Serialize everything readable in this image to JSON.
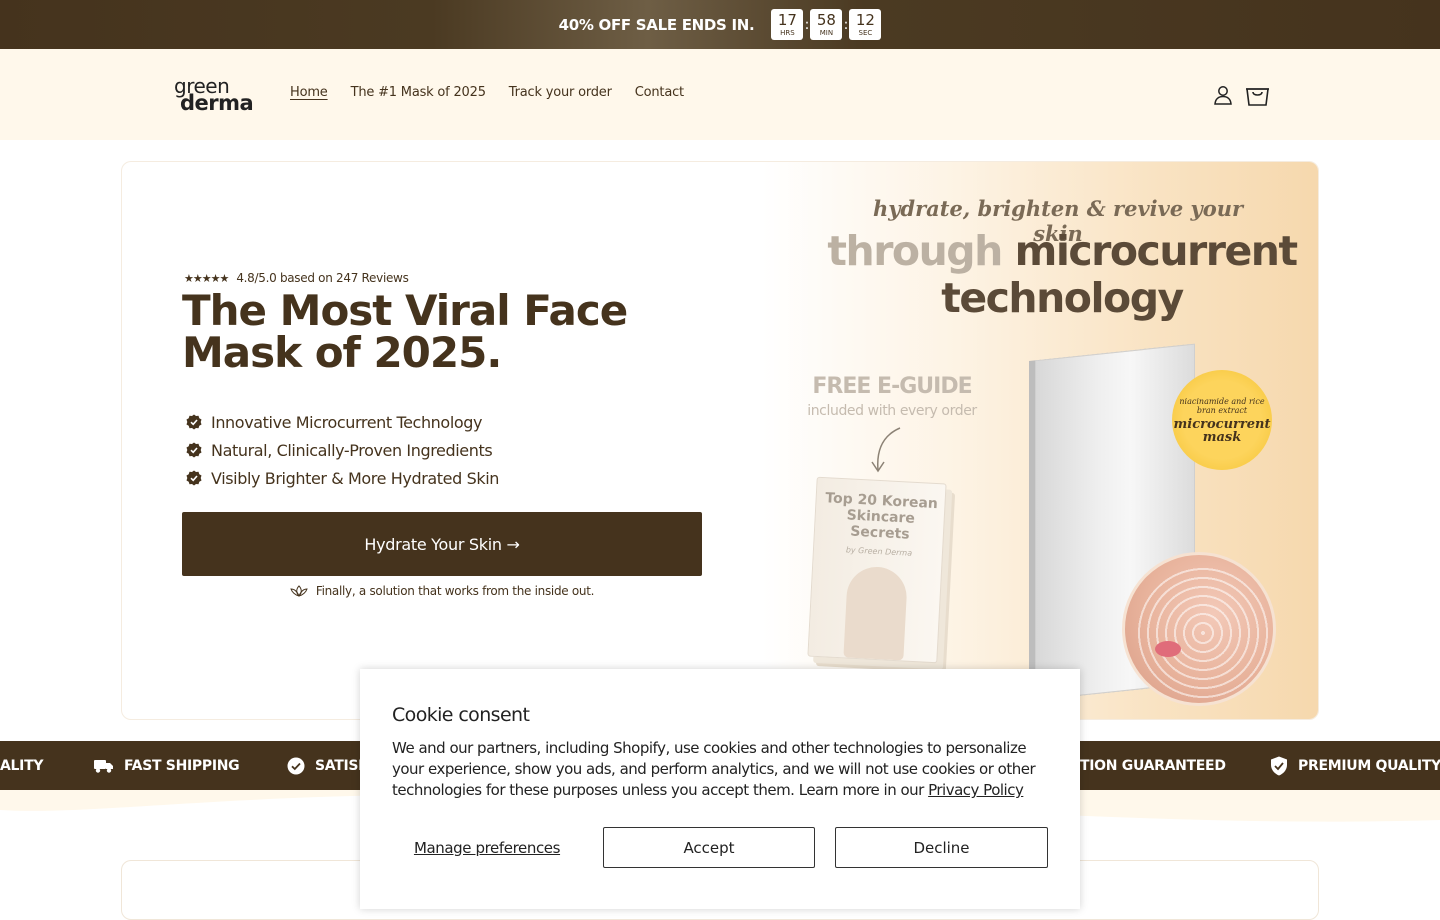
{
  "announcement": {
    "text": "40% OFF SALE ENDS IN.",
    "timer": [
      {
        "value": "17",
        "unit": "HRS"
      },
      {
        "value": "58",
        "unit": "MIN"
      },
      {
        "value": "12",
        "unit": "SEC"
      }
    ],
    "separator": ":"
  },
  "header": {
    "logo_line1": "green",
    "logo_line2": "derma",
    "nav": [
      "Home",
      "The #1 Mask of 2025",
      "Track your order",
      "Contact"
    ],
    "active_nav": "Home",
    "account_icon": "user-icon",
    "cart_icon": "shopping-bag-icon"
  },
  "hero": {
    "stars": "★★★★★",
    "rating_text": "4.8/5.0 based on 247 Reviews",
    "headline": "The Most Viral Face Mask of 2025.",
    "features": [
      "Innovative Microcurrent Technology",
      "Natural, Clinically-Proven Ingredients",
      "Visibly Brighter & More Hydrated Skin"
    ],
    "cta_label": "Hydrate Your Skin →",
    "tagline": "Finally, a solution that works from the inside out.",
    "image": {
      "script_line": "hydrate, brighten & revive your skin",
      "big_line1_light": "through ",
      "big_line1_dark": "microcurrent",
      "big_line2": "technology",
      "free_title": "FREE E-GUIDE",
      "free_sub": "included with every order",
      "book_title": "Top 20 Korean Skincare Secrets",
      "book_by": "by Green Derma",
      "badge_small": "niacinamide and rice bran extract",
      "badge_big": "microcurrent mask"
    }
  },
  "trust_bar": {
    "items": [
      {
        "label": "ALITY",
        "icon": "shield-check-icon"
      },
      {
        "label": "FAST SHIPPING",
        "icon": "truck-icon"
      },
      {
        "label": "SATISF",
        "icon": "check-circle-icon"
      },
      {
        "label": "TION GUARANTEED",
        "icon": "check-circle-icon"
      },
      {
        "label": "PREMIUM QUALITY",
        "icon": "shield-check-icon"
      }
    ]
  },
  "cookie": {
    "title": "Cookie consent",
    "body": "We and our partners, including Shopify, use cookies and other technologies to personalize your experience, show you ads, and perform analytics, and we will not use cookies or other technologies for these purposes unless you accept them. Learn more in our ",
    "link": "Privacy Policy",
    "manage": "Manage preferences",
    "accept": "Accept",
    "decline": "Decline"
  },
  "colors": {
    "brand_brown": "#45331d",
    "header_bg": "#fff8eb",
    "badge_yellow": "#fdd45c"
  }
}
